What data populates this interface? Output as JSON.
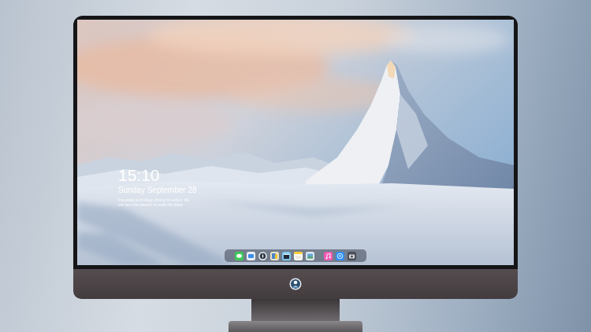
{
  "lock_screen": {
    "time": "15:10",
    "date": "Sunday September 28",
    "message_lines": [
      "Innovating technology, driving innovation. We",
      "use your own wisdom to create the future"
    ]
  }
}
